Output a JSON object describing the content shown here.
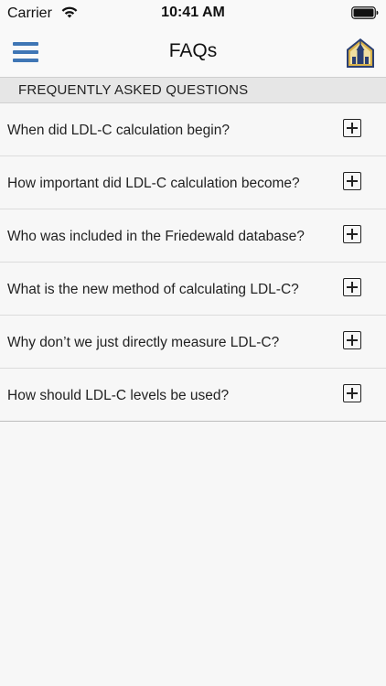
{
  "status_bar": {
    "carrier": "Carrier",
    "time": "10:41 AM"
  },
  "nav": {
    "title": "FAQs",
    "menu_icon": "hamburger-menu-icon",
    "logo_icon": "hospital-logo-icon",
    "accent_color": "#3f76b5"
  },
  "section": {
    "header": "FREQUENTLY ASKED QUESTIONS"
  },
  "faqs": [
    {
      "question": "When did LDL-C calculation begin?",
      "expanded": false
    },
    {
      "question": "How important did LDL-C calculation become?",
      "expanded": false
    },
    {
      "question": "Who was included in the Friedewald database?",
      "expanded": false
    },
    {
      "question": "What is the new method of calculating LDL-C?",
      "expanded": false
    },
    {
      "question": "Why don’t we just directly measure LDL-C?",
      "expanded": false
    },
    {
      "question": "How should LDL-C levels be used?",
      "expanded": false
    }
  ]
}
